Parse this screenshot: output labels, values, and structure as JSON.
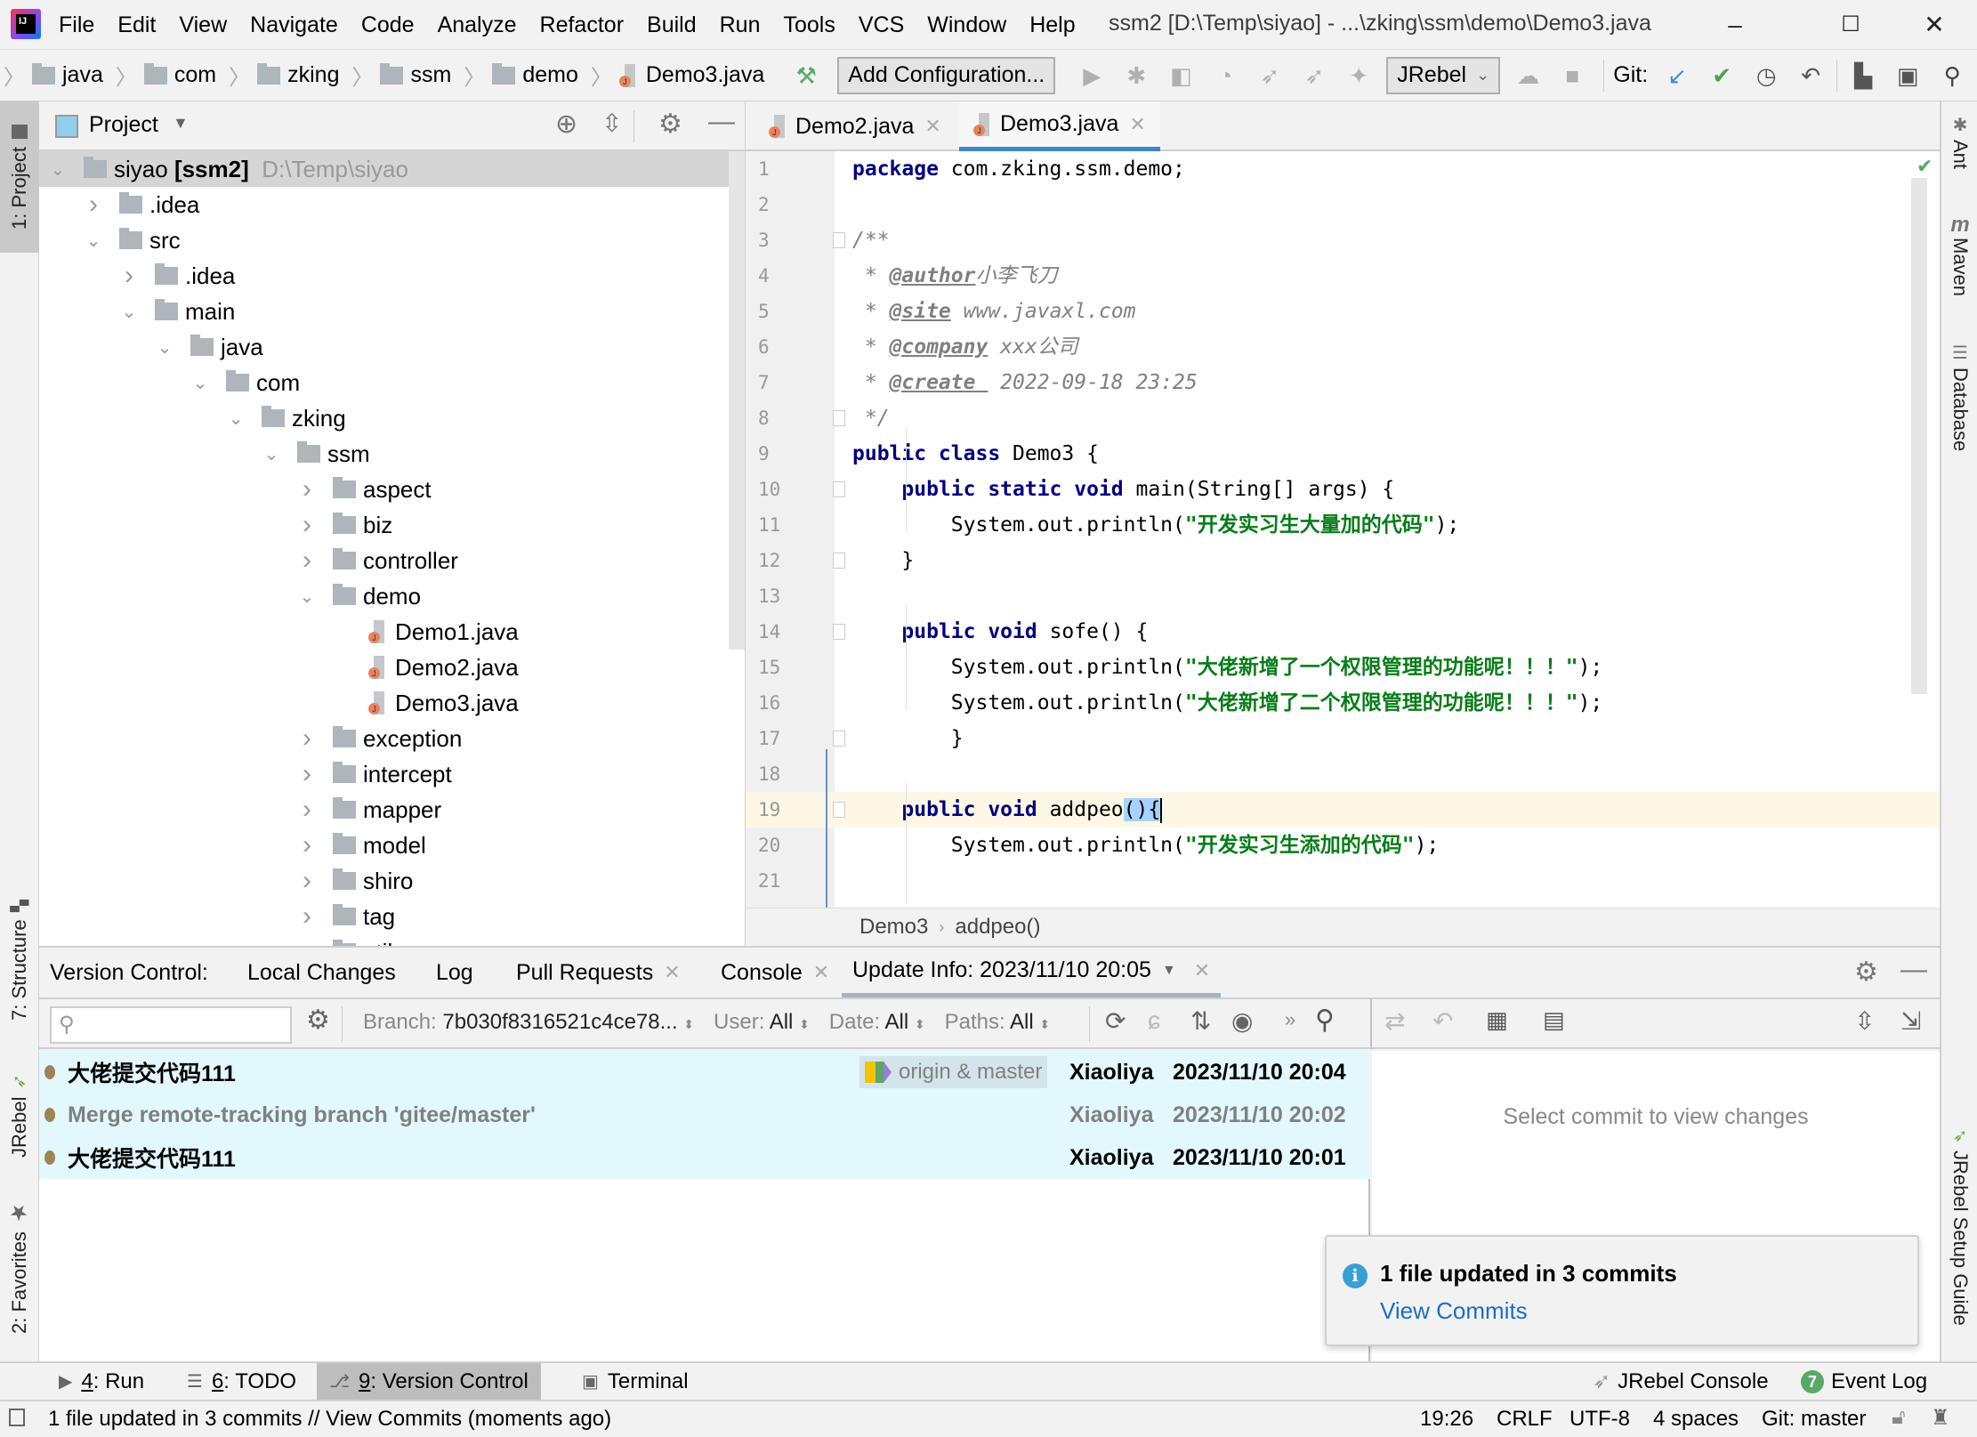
{
  "window": {
    "title": "ssm2 [D:\\Temp\\siyao] - ...\\zking\\ssm\\demo\\Demo3.java",
    "logo": "IJ",
    "controls": {
      "minimize": "–",
      "maximize": "☐",
      "close": "✕"
    }
  },
  "menu": [
    "File",
    "Edit",
    "View",
    "Navigate",
    "Code",
    "Analyze",
    "Refactor",
    "Build",
    "Run",
    "Tools",
    "VCS",
    "Window",
    "Help"
  ],
  "navbar": {
    "breadcrumbs": [
      "java",
      "com",
      "zking",
      "ssm",
      "demo",
      "Demo3.java"
    ],
    "add_configuration": "Add Configuration...",
    "jrebel_select": "JRebel",
    "git_label": "Git:"
  },
  "left_strip": {
    "project": "1: Project",
    "structure": "7: Structure",
    "jrebel": "JRebel",
    "favorites": "2: Favorites"
  },
  "right_strip": {
    "ant": "Ant",
    "maven": "Maven",
    "database": "Database",
    "jrebel_guide": "JRebel Setup Guide"
  },
  "project": {
    "header": "Project",
    "root": {
      "name": "siyao",
      "module": "[ssm2]",
      "path": "D:\\Temp\\siyao"
    },
    "tree": [
      {
        "label": ".idea",
        "depth": 1,
        "state": "collapsed",
        "type": "folder"
      },
      {
        "label": "src",
        "depth": 1,
        "state": "expanded",
        "type": "folder"
      },
      {
        "label": ".idea",
        "depth": 2,
        "state": "collapsed",
        "type": "folder"
      },
      {
        "label": "main",
        "depth": 2,
        "state": "expanded",
        "type": "folder"
      },
      {
        "label": "java",
        "depth": 3,
        "state": "expanded",
        "type": "folder"
      },
      {
        "label": "com",
        "depth": 4,
        "state": "expanded",
        "type": "folder"
      },
      {
        "label": "zking",
        "depth": 5,
        "state": "expanded",
        "type": "folder"
      },
      {
        "label": "ssm",
        "depth": 6,
        "state": "expanded",
        "type": "folder"
      },
      {
        "label": "aspect",
        "depth": 7,
        "state": "collapsed",
        "type": "folder"
      },
      {
        "label": "biz",
        "depth": 7,
        "state": "collapsed",
        "type": "folder"
      },
      {
        "label": "controller",
        "depth": 7,
        "state": "collapsed",
        "type": "folder"
      },
      {
        "label": "demo",
        "depth": 7,
        "state": "expanded",
        "type": "folder"
      },
      {
        "label": "Demo1.java",
        "depth": 8,
        "state": "leaf",
        "type": "java"
      },
      {
        "label": "Demo2.java",
        "depth": 8,
        "state": "leaf",
        "type": "java"
      },
      {
        "label": "Demo3.java",
        "depth": 8,
        "state": "leaf",
        "type": "java"
      },
      {
        "label": "exception",
        "depth": 7,
        "state": "collapsed",
        "type": "folder"
      },
      {
        "label": "intercept",
        "depth": 7,
        "state": "collapsed",
        "type": "folder"
      },
      {
        "label": "mapper",
        "depth": 7,
        "state": "collapsed",
        "type": "folder"
      },
      {
        "label": "model",
        "depth": 7,
        "state": "collapsed",
        "type": "folder"
      },
      {
        "label": "shiro",
        "depth": 7,
        "state": "collapsed",
        "type": "folder"
      },
      {
        "label": "tag",
        "depth": 7,
        "state": "collapsed",
        "type": "folder"
      },
      {
        "label": "util",
        "depth": 7,
        "state": "collapsed",
        "type": "folder"
      }
    ]
  },
  "editor": {
    "tabs": [
      {
        "label": "Demo2.java",
        "active": false
      },
      {
        "label": "Demo3.java",
        "active": true
      }
    ],
    "current_line": 19,
    "lines": [
      {
        "n": "1",
        "tokens": [
          [
            "kw",
            "package"
          ],
          [
            "t",
            " com.zking.ssm.demo;"
          ]
        ]
      },
      {
        "n": "2",
        "tokens": []
      },
      {
        "n": "3",
        "tokens": [
          [
            "cm",
            "/**"
          ]
        ]
      },
      {
        "n": "4",
        "tokens": [
          [
            "cm",
            " * "
          ],
          [
            "tag",
            "@author"
          ],
          [
            "cm",
            "小李飞刀"
          ]
        ]
      },
      {
        "n": "5",
        "tokens": [
          [
            "cm",
            " * "
          ],
          [
            "tag",
            "@site"
          ],
          [
            "cm",
            " www.javaxl.com"
          ]
        ]
      },
      {
        "n": "6",
        "tokens": [
          [
            "cm",
            " * "
          ],
          [
            "tag",
            "@company"
          ],
          [
            "cm",
            " xxx公司"
          ]
        ]
      },
      {
        "n": "7",
        "tokens": [
          [
            "cm",
            " * "
          ],
          [
            "tag",
            "@create "
          ],
          [
            "cm",
            " 2022-09-18 23:25"
          ]
        ]
      },
      {
        "n": "8",
        "tokens": [
          [
            "cm",
            " */"
          ]
        ]
      },
      {
        "n": "9",
        "tokens": [
          [
            "kw",
            "public class"
          ],
          [
            "t",
            " Demo3 {"
          ]
        ]
      },
      {
        "n": "10",
        "tokens": [
          [
            "t",
            "    "
          ],
          [
            "kw",
            "public static void"
          ],
          [
            "t",
            " main(String[] args) {"
          ]
        ]
      },
      {
        "n": "11",
        "tokens": [
          [
            "t",
            "        System.out.println("
          ],
          [
            "str",
            "\"开发实习生大量加的代码\""
          ],
          [
            "t",
            ");"
          ]
        ]
      },
      {
        "n": "12",
        "tokens": [
          [
            "t",
            "    }"
          ]
        ]
      },
      {
        "n": "13",
        "tokens": []
      },
      {
        "n": "14",
        "tokens": [
          [
            "t",
            "    "
          ],
          [
            "kw",
            "public void"
          ],
          [
            "t",
            " sofe() {"
          ]
        ]
      },
      {
        "n": "15",
        "tokens": [
          [
            "t",
            "        System.out.println("
          ],
          [
            "str",
            "\"大佬新增了一个权限管理的功能呢！！！\""
          ],
          [
            "t",
            ");"
          ]
        ]
      },
      {
        "n": "16",
        "tokens": [
          [
            "t",
            "        System.out.println("
          ],
          [
            "str",
            "\"大佬新增了二个权限管理的功能呢！！！\""
          ],
          [
            "t",
            ");"
          ]
        ]
      },
      {
        "n": "17",
        "tokens": [
          [
            "t",
            "        }"
          ]
        ]
      },
      {
        "n": "18",
        "tokens": []
      },
      {
        "n": "19",
        "tokens": [
          [
            "t",
            "    "
          ],
          [
            "kw",
            "public void"
          ],
          [
            "t",
            " addpeo"
          ],
          [
            "hl",
            "(){"
          ]
        ]
      },
      {
        "n": "20",
        "tokens": [
          [
            "t",
            "        System.out.println("
          ],
          [
            "str",
            "\"开发实习生添加的代码\""
          ],
          [
            "t",
            ");"
          ]
        ]
      },
      {
        "n": "21",
        "tokens": []
      }
    ],
    "breadcrumb": [
      "Demo3",
      "addpeo()"
    ]
  },
  "version_control": {
    "label": "Version Control:",
    "tabs": [
      {
        "label": "Local Changes",
        "closable": false
      },
      {
        "label": "Log",
        "closable": false
      },
      {
        "label": "Pull Requests",
        "closable": true
      },
      {
        "label": "Console",
        "closable": true
      },
      {
        "label": "Update Info: 2023/11/10 20:05",
        "closable": true,
        "active": true
      }
    ],
    "search_placeholder": "",
    "filters": {
      "branch_label": "Branch:",
      "branch_value": "7b030f8316521c4ce78...",
      "user_label": "User:",
      "user_value": "All",
      "date_label": "Date:",
      "date_value": "All",
      "paths_label": "Paths:",
      "paths_value": "All"
    },
    "commits": [
      {
        "message": "大佬提交代码111",
        "refs": "origin & master",
        "author": "Xiaoliya",
        "date": "2023/11/10 20:04",
        "style": "bold"
      },
      {
        "message": "Merge remote-tracking branch 'gitee/master'",
        "refs": "",
        "author": "Xiaoliya",
        "date": "2023/11/10 20:02",
        "style": "grey"
      },
      {
        "message": "大佬提交代码111",
        "refs": "",
        "author": "Xiaoliya",
        "date": "2023/11/10 20:01",
        "style": "bold"
      }
    ],
    "details_placeholder": "Select commit to view changes"
  },
  "notification": {
    "title": "1 file updated in 3 commits",
    "link": "View Commits"
  },
  "bottom_tabs": [
    {
      "key": "4",
      "label": ": Run",
      "active": false
    },
    {
      "key": "6",
      "label": ": TODO",
      "active": false
    },
    {
      "key": "9",
      "label": ": Version Control",
      "active": true
    },
    {
      "key": "",
      "label": "Terminal",
      "active": false
    }
  ],
  "bottom_right": {
    "jrebel_console": "JRebel Console",
    "event_log": "Event Log",
    "event_count": "7"
  },
  "status": {
    "message": "1 file updated in 3 commits // View Commits (moments ago)",
    "position": "19:26",
    "line_sep": "CRLF",
    "encoding": "UTF-8",
    "indent": "4 spaces",
    "vcs": "Git: master"
  },
  "colors": {
    "accent": "#4083c9",
    "keyword": "#000080",
    "string": "#067d17",
    "commit_bg": "#e2f8fd",
    "link": "#1a6fc2"
  }
}
